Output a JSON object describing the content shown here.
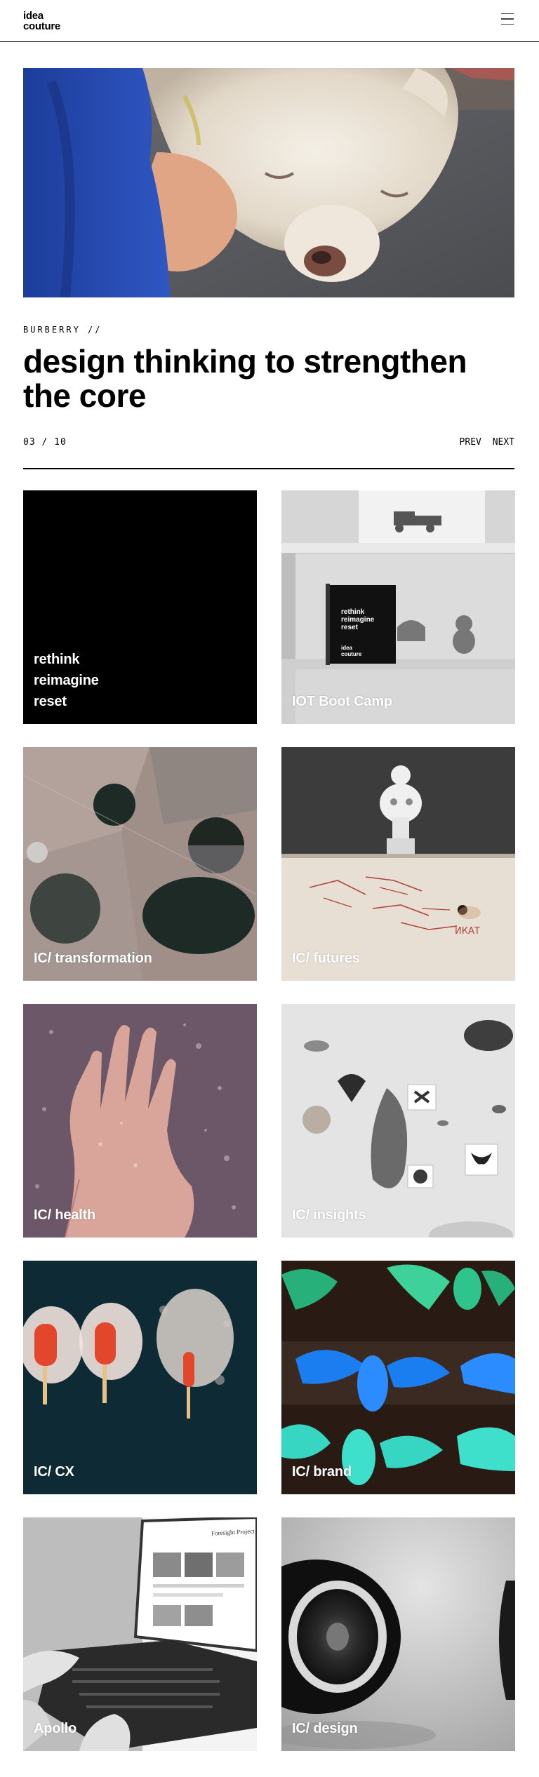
{
  "header": {
    "logo_line1": "idea",
    "logo_line2": "couture"
  },
  "article": {
    "kicker": "BURBERRY //",
    "title": "design thinking to strengthen the core",
    "counter": "03 / 10",
    "prev_label": "PREV",
    "next_label": "NEXT"
  },
  "tiles": [
    {
      "label": "rethink\nreimagine\nreset"
    },
    {
      "label": "IOT Boot Camp",
      "box_text": "rethink\nreimagine\nreset",
      "box_logo": "idea\ncouture"
    },
    {
      "label": "IC/ transformation"
    },
    {
      "label": "IC/ futures",
      "scribble": "ИКАТ"
    },
    {
      "label": "IC/ health"
    },
    {
      "label": "IC/ insights"
    },
    {
      "label": "IC/ CX"
    },
    {
      "label": "IC/ brand"
    },
    {
      "label": "Apollo",
      "screen_title": "Foresight Project"
    },
    {
      "label": "IC/ design"
    }
  ]
}
